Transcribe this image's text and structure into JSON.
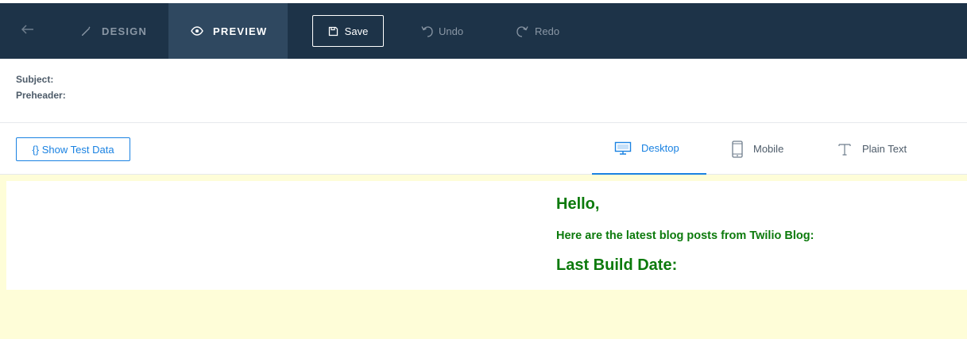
{
  "toolbar": {
    "tabs": {
      "design": {
        "label": "DESIGN",
        "icon": "pencil-icon"
      },
      "preview": {
        "label": "PREVIEW",
        "icon": "eye-icon"
      }
    },
    "save_label": "Save",
    "undo_label": "Undo",
    "redo_label": "Redo",
    "colors": {
      "background": "#1d3348",
      "active_tab": "#2f4860"
    }
  },
  "meta": {
    "subject_label": "Subject:",
    "subject_value": "",
    "preheader_label": "Preheader:",
    "preheader_value": ""
  },
  "viewbar": {
    "test_data_label": "{} Show Test Data",
    "views": {
      "desktop": {
        "label": "Desktop",
        "icon": "monitor-icon",
        "active": true
      },
      "mobile": {
        "label": "Mobile",
        "icon": "phone-icon"
      },
      "plain": {
        "label": "Plain Text",
        "icon": "text-icon"
      }
    },
    "accent_color": "#1a82e2"
  },
  "preview": {
    "greeting": "Hello,",
    "intro": "Here are the latest blog posts from Twilio Blog:",
    "build_date_label": "Last Build Date:",
    "text_color": "#0c7a0c",
    "background_color": "#fefdd8"
  }
}
